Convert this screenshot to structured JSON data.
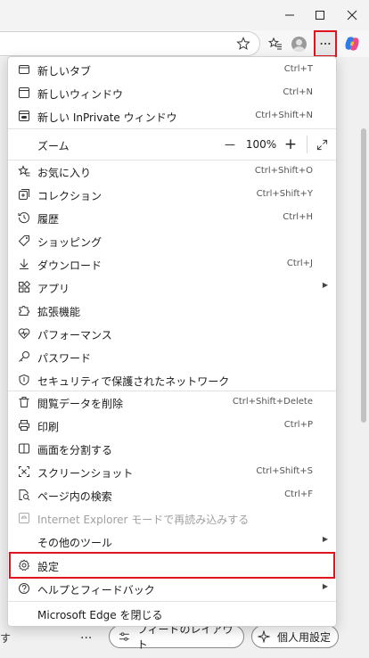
{
  "menu": {
    "new_tab": {
      "label": "新しいタブ",
      "shortcut": "Ctrl+T"
    },
    "new_window": {
      "label": "新しいウィンドウ",
      "shortcut": "Ctrl+N"
    },
    "new_inprivate": {
      "label": "新しい InPrivate ウィンドウ",
      "shortcut": "Ctrl+Shift+N"
    },
    "zoom": {
      "label": "ズーム",
      "minus": "—",
      "value": "100%",
      "plus": "+"
    },
    "favorites": {
      "label": "お気に入り",
      "shortcut": "Ctrl+Shift+O"
    },
    "collections": {
      "label": "コレクション",
      "shortcut": "Ctrl+Shift+Y"
    },
    "history": {
      "label": "履歴",
      "shortcut": "Ctrl+H"
    },
    "shopping": {
      "label": "ショッピング"
    },
    "downloads": {
      "label": "ダウンロード",
      "shortcut": "Ctrl+J"
    },
    "apps": {
      "label": "アプリ"
    },
    "extensions": {
      "label": "拡張機能"
    },
    "performance": {
      "label": "パフォーマンス"
    },
    "passwords": {
      "label": "パスワード"
    },
    "secure_network": {
      "label": "セキュリティで保護されたネットワーク"
    },
    "delete_data": {
      "label": "閲覧データを削除",
      "shortcut": "Ctrl+Shift+Delete"
    },
    "print": {
      "label": "印刷",
      "shortcut": "Ctrl+P"
    },
    "split_screen": {
      "label": "画面を分割する"
    },
    "screenshot": {
      "label": "スクリーンショット",
      "shortcut": "Ctrl+Shift+S"
    },
    "find_in_page": {
      "label": "ページ内の検索",
      "shortcut": "Ctrl+F"
    },
    "ie_mode": {
      "label": "Internet Explorer モードで再読み込みする"
    },
    "more_tools": {
      "label": "その他のツール"
    },
    "settings": {
      "label": "設定"
    },
    "help_feedback": {
      "label": "ヘルプとフィードバック"
    },
    "close_edge": {
      "label": "Microsoft Edge を閉じる"
    }
  },
  "bottom": {
    "left_text": "す",
    "dots": "...",
    "feed_layout": "フィードのレイアウト",
    "personal_settings": "個人用設定"
  },
  "colors": {
    "highlight": "#e0141e"
  }
}
